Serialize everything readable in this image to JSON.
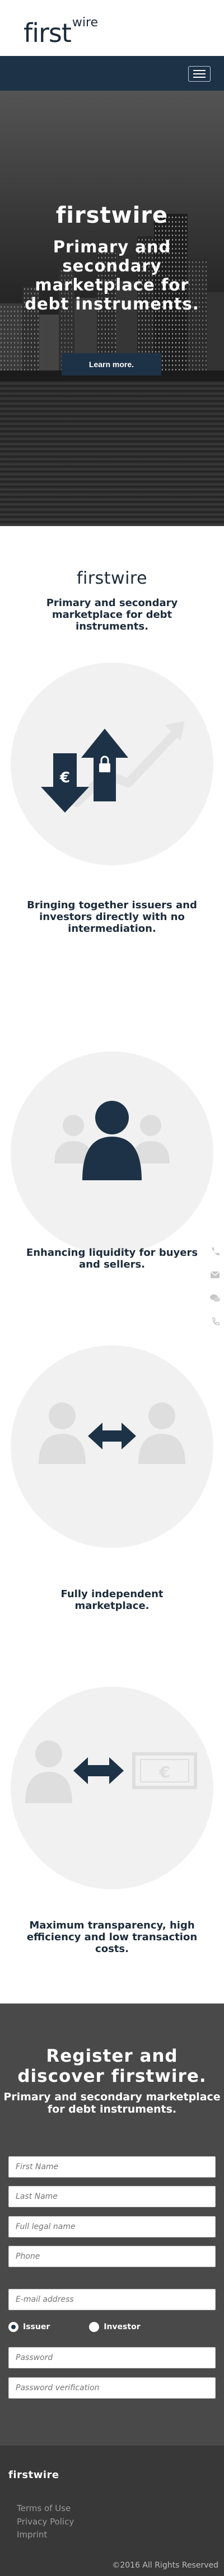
{
  "header": {
    "logo_main": "first",
    "logo_super": "wire"
  },
  "hero": {
    "title": "firstwire",
    "subtitle": "Primary and secondary marketplace for debt instruments.",
    "button_label": "Learn more."
  },
  "intro": {
    "logo": "firstwire",
    "subtitle": "Primary and secondary marketplace for debt instruments."
  },
  "features": [
    {
      "text": "Bringing together issuers and investors directly with no intermediation.",
      "icon": "euro-lock-arrows-icon"
    },
    {
      "text": "Enhancing liquidity for buyers and sellers.",
      "icon": "users-group-icon"
    },
    {
      "text": "Fully independent marketplace.",
      "icon": "users-exchange-icon"
    },
    {
      "text": "Maximum transparency, high efficiency and low transaction costs.",
      "icon": "user-money-exchange-icon"
    }
  ],
  "side_icons": [
    "phone-icon",
    "mail-icon",
    "chat-icon",
    "phone-alt-icon"
  ],
  "register": {
    "title": "Register and discover firstwire.",
    "subtitle": "Primary and secondary marketplace for debt instruments.",
    "fields": {
      "first_name": "First Name",
      "last_name": "Last Name",
      "full_legal_name": "Full legal name",
      "phone": "Phone",
      "email": "E-mail address",
      "password": "Password",
      "password_verification": "Password verification"
    },
    "radio_issuer": "Issuer",
    "radio_investor": "Investor"
  },
  "footer": {
    "logo": "firstwire",
    "links": [
      "Terms of Use",
      "Privacy Policy",
      "Imprint"
    ],
    "copyright": "©2016 All Rights Reserved"
  },
  "colors": {
    "navy": "#1d3247",
    "light_gray": "#f1f1f1",
    "icon_gray": "#d9d9d9",
    "register_bg": "#494949",
    "footer_bg": "#383838"
  }
}
